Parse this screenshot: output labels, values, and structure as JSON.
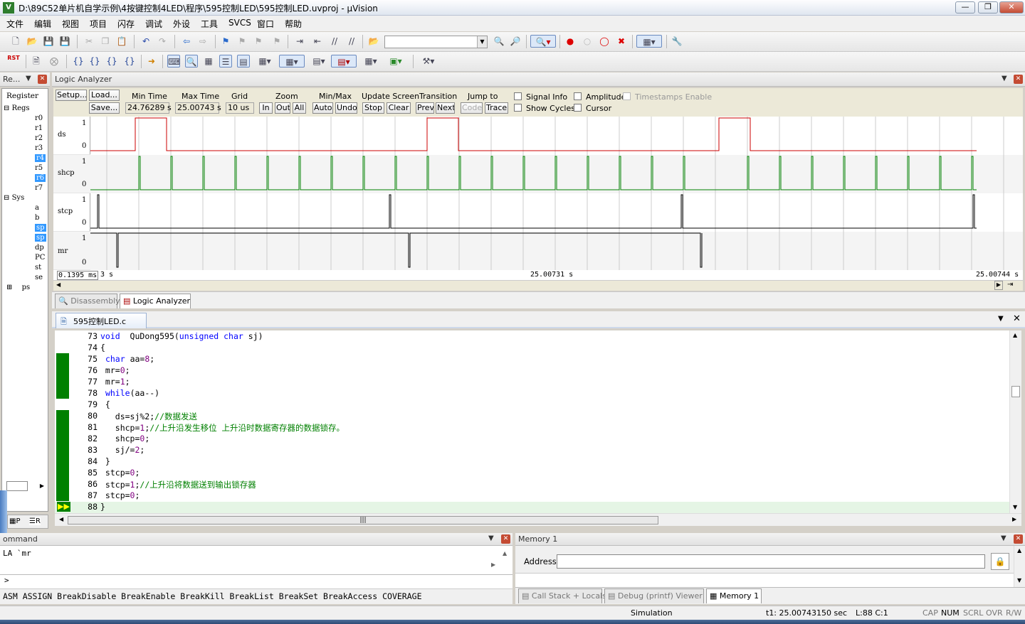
{
  "window": {
    "title": "D:\\89C52单片机自学示例\\4按键控制4LED\\程序\\595控制LED\\595控制LED.uvproj - µVision",
    "app_icon": "V"
  },
  "menu": [
    "文件",
    "编辑",
    "视图",
    "项目",
    "闪存",
    "调试",
    "外设",
    "工具",
    "SVCS",
    "窗口",
    "帮助"
  ],
  "toolbar2": {
    "rst_label": "RST"
  },
  "register_panel": {
    "title": "Re...",
    "header": "Register",
    "tree": [
      {
        "label": "Regs",
        "level": 0
      },
      {
        "label": "r0",
        "level": 2
      },
      {
        "label": "r1",
        "level": 2
      },
      {
        "label": "r2",
        "level": 2
      },
      {
        "label": "r3",
        "level": 2
      },
      {
        "label": "r4",
        "level": 2,
        "selected": true
      },
      {
        "label": "r5",
        "level": 2
      },
      {
        "label": "r6",
        "level": 2,
        "selected": true
      },
      {
        "label": "r7",
        "level": 2
      },
      {
        "label": "Sys",
        "level": 0
      },
      {
        "label": "a",
        "level": 2
      },
      {
        "label": "b",
        "level": 2
      },
      {
        "label": "sp",
        "level": 2,
        "selected": true
      },
      {
        "label": "sp",
        "level": 2,
        "selected": true
      },
      {
        "label": "dp",
        "level": 2
      },
      {
        "label": "PC",
        "level": 2
      },
      {
        "label": "st",
        "level": 2
      },
      {
        "label": "se",
        "level": 2
      },
      {
        "label": "ps",
        "level": 1
      }
    ],
    "tab_p": "P",
    "tab_r": "R"
  },
  "logic_analyzer": {
    "title": "Logic Analyzer",
    "setup": "Setup...",
    "load": "Load...",
    "save": "Save...",
    "min_time_label": "Min Time",
    "min_time": "24.76289 s",
    "max_time_label": "Max Time",
    "max_time": "25.00743 s",
    "grid_label": "Grid",
    "grid": "10 us",
    "zoom_label": "Zoom",
    "zoom_in": "In",
    "zoom_out": "Out",
    "zoom_all": "All",
    "minmax_label": "Min/Max",
    "auto": "Auto",
    "undo": "Undo",
    "update_label": "Update Screen",
    "stop": "Stop",
    "clear": "Clear",
    "transition_label": "Transition",
    "prev": "Prev",
    "next": "Next",
    "jump_label": "Jump to",
    "code": "Code",
    "trace": "Trace",
    "signal_info": "Signal Info",
    "show_cycles": "Show Cycles",
    "amplitude": "Amplitude",
    "cursor": "Cursor",
    "timestamps": "Timestamps Enable",
    "signals": [
      {
        "name": "ds",
        "hi": "1",
        "lo": "0"
      },
      {
        "name": "shcp",
        "hi": "1",
        "lo": "0"
      },
      {
        "name": "stcp",
        "hi": "1",
        "lo": "0"
      },
      {
        "name": "mr",
        "hi": "1",
        "lo": "0"
      }
    ],
    "axis_left_box": "0.1395 ms",
    "axis_left": "3 s",
    "axis_mid": "25.00731 s",
    "axis_right": "25.00744 s",
    "colors": {
      "ds": "#cc0000",
      "shcp": "#008000",
      "stcp": "#000000",
      "mr": "#000000"
    }
  },
  "mid_tabs": {
    "disassembly": "Disassembly",
    "logic": "Logic Analyzer"
  },
  "editor": {
    "file_tab": "595控制LED.c",
    "lines": [
      {
        "n": "73",
        "tokens": [
          [
            "kw",
            "void"
          ],
          [
            "",
            "  QuDong595("
          ],
          [
            "kw",
            "unsigned"
          ],
          [
            "",
            " "
          ],
          [
            "kw",
            "char"
          ],
          [
            "",
            " sj)"
          ]
        ]
      },
      {
        "n": "74",
        "tokens": [
          [
            "",
            "{"
          ]
        ]
      },
      {
        "n": "75",
        "tokens": [
          [
            "",
            " "
          ],
          [
            "kw",
            "char"
          ],
          [
            "",
            " aa="
          ],
          [
            "num",
            "8"
          ],
          [
            "",
            ";"
          ]
        ]
      },
      {
        "n": "76",
        "tokens": [
          [
            "",
            " mr="
          ],
          [
            "num",
            "0"
          ],
          [
            "",
            ";"
          ]
        ]
      },
      {
        "n": "77",
        "tokens": [
          [
            "",
            " mr="
          ],
          [
            "num",
            "1"
          ],
          [
            "",
            ";"
          ]
        ]
      },
      {
        "n": "78",
        "tokens": [
          [
            "",
            " "
          ],
          [
            "kw",
            "while"
          ],
          [
            "",
            "(aa--)"
          ]
        ]
      },
      {
        "n": "79",
        "tokens": [
          [
            "",
            " {"
          ]
        ]
      },
      {
        "n": "80",
        "tokens": [
          [
            "",
            "   ds=sj%2;"
          ],
          [
            "cm",
            "//数据发送"
          ]
        ]
      },
      {
        "n": "81",
        "tokens": [
          [
            "",
            "   shcp="
          ],
          [
            "num",
            "1"
          ],
          [
            "",
            ";"
          ],
          [
            "cm",
            "//上升沿发生移位 上升沿时数据寄存器的数据锁存。"
          ]
        ]
      },
      {
        "n": "82",
        "tokens": [
          [
            "",
            "   shcp="
          ],
          [
            "num",
            "0"
          ],
          [
            "",
            ";"
          ]
        ]
      },
      {
        "n": "83",
        "tokens": [
          [
            "",
            "   sj/="
          ],
          [
            "num",
            "2"
          ],
          [
            "",
            ";"
          ]
        ]
      },
      {
        "n": "84",
        "tokens": [
          [
            "",
            " }"
          ]
        ]
      },
      {
        "n": "85",
        "tokens": [
          [
            "",
            " stcp="
          ],
          [
            "num",
            "0"
          ],
          [
            "",
            ";"
          ]
        ]
      },
      {
        "n": "86",
        "tokens": [
          [
            "",
            " stcp="
          ],
          [
            "num",
            "1"
          ],
          [
            "",
            ";"
          ],
          [
            "cm",
            "//上升沿将数据送到输出锁存器"
          ]
        ]
      },
      {
        "n": "87",
        "tokens": [
          [
            "",
            " stcp="
          ],
          [
            "num",
            "0"
          ],
          [
            "",
            ";"
          ]
        ]
      },
      {
        "n": "88",
        "tokens": [
          [
            "",
            "}"
          ]
        ]
      }
    ]
  },
  "command": {
    "title": "ommand",
    "output": "LA `mr",
    "prompt": ">",
    "help": "ASM ASSIGN BreakDisable BreakEnable BreakKill BreakList BreakSet BreakAccess COVERAGE"
  },
  "memory": {
    "title": "Memory 1",
    "address_label": "Address:",
    "address_value": ""
  },
  "bottom_tabs": {
    "callstack": "Call Stack + Locals",
    "debug": "Debug (printf) Viewer",
    "memory": "Memory 1"
  },
  "status": {
    "mode": "Simulation",
    "time": "t1: 25.00743150 sec",
    "pos": "L:88 C:1",
    "cap": "CAP",
    "num": "NUM",
    "scrl": "SCRL",
    "ovr": "OVR",
    "rw": "R/W"
  }
}
